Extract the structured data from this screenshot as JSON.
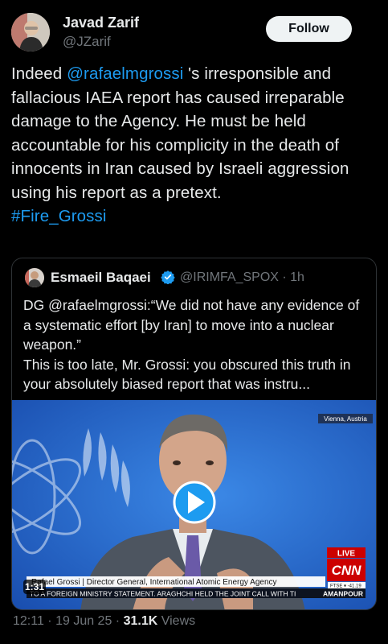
{
  "author": {
    "name": "Javad Zarif",
    "handle": "@JZarif",
    "follow_label": "Follow"
  },
  "tweet": {
    "pre": "Indeed ",
    "mention": "@rafaelmgrossi",
    "post": " 's irresponsible and fallacious IAEA report has caused irreparable damage to the Agency. He must be held accountable for his complicity in the death of innocents in Iran caused by Israeli aggression using his report as a pretext.",
    "hashtag": "#Fire_Grossi"
  },
  "quote": {
    "name": "Esmaeil Baqaei",
    "handle_time": "@IRIMFA_SPOX · 1h",
    "text_line1": "DG @rafaelmgrossi:“We did not have any evidence of a systematic effort [by Iran] to move into a nuclear weapon.”",
    "text_line2": "This is too late, Mr. Grossi: you obscured this truth in your absolutely biased report that was instru...",
    "video": {
      "location": "Vienna, Austria",
      "live": "LIVE",
      "network": "CNN",
      "lower_third": "Rafael Grossi  |  Director General, International Atomic Energy Agency",
      "ticker": "TO A FOREIGN MINISTRY STATEMENT. ARAGHCHI HELD THE JOINT CALL WITH TI",
      "ticker_show": "AMANPOUR",
      "index": "FTSE ▾  -41.19",
      "duration": "1:31"
    }
  },
  "meta": {
    "time_date": "12:11 · 19 Jun 25 · ",
    "views_count": "31.1K",
    "views_label": " Views"
  },
  "colors": {
    "accent": "#1d9bf0",
    "background": "#000000",
    "video_bg": "#1e5fc2",
    "cnn_red": "#cc0000"
  }
}
